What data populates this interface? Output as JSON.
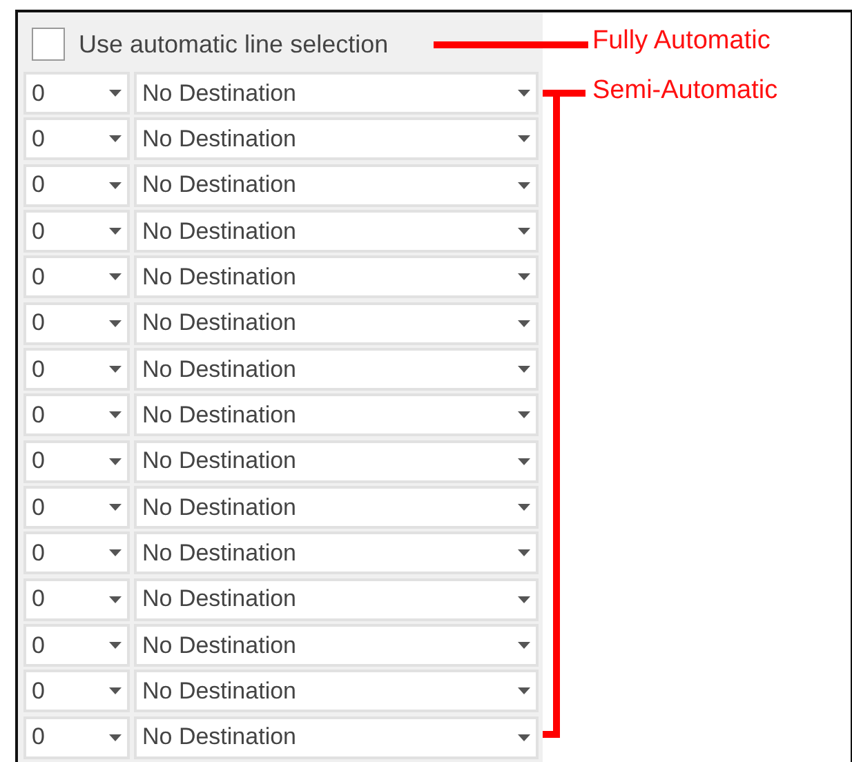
{
  "auto_selection": {
    "label": "Use automatic line selection",
    "checked": false
  },
  "rows": [
    {
      "line": "0",
      "destination": "No Destination"
    },
    {
      "line": "0",
      "destination": "No Destination"
    },
    {
      "line": "0",
      "destination": "No Destination"
    },
    {
      "line": "0",
      "destination": "No Destination"
    },
    {
      "line": "0",
      "destination": "No Destination"
    },
    {
      "line": "0",
      "destination": "No Destination"
    },
    {
      "line": "0",
      "destination": "No Destination"
    },
    {
      "line": "0",
      "destination": "No Destination"
    },
    {
      "line": "0",
      "destination": "No Destination"
    },
    {
      "line": "0",
      "destination": "No Destination"
    },
    {
      "line": "0",
      "destination": "No Destination"
    },
    {
      "line": "0",
      "destination": "No Destination"
    },
    {
      "line": "0",
      "destination": "No Destination"
    },
    {
      "line": "0",
      "destination": "No Destination"
    },
    {
      "line": "0",
      "destination": "No Destination"
    }
  ],
  "annotations": [
    {
      "label": "Fully Automatic"
    },
    {
      "label": "Semi-Automatic"
    }
  ]
}
